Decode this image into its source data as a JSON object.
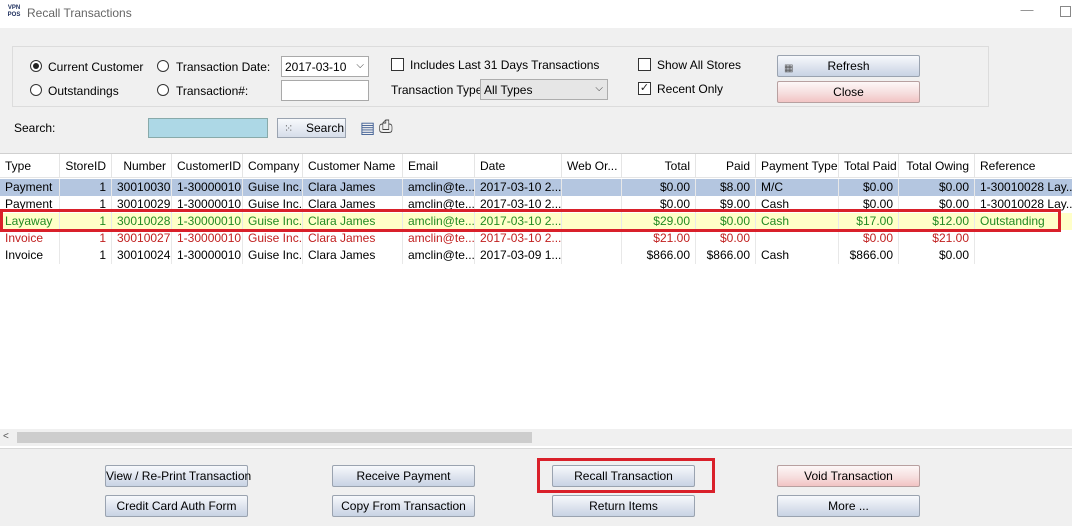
{
  "window": {
    "logo_text": "VPN POS",
    "title": "Recall Transactions",
    "minimize_glyph": "—"
  },
  "filters": {
    "current_customer": "Current Customer",
    "outstandings": "Outstandings",
    "transaction_date": "Transaction Date:",
    "transaction_date_value": "2017-03-10",
    "transaction_no": "Transaction#:",
    "include_last_31": "Includes Last 31 Days Transactions",
    "transaction_type_label": "Transaction Type:",
    "transaction_type_value": "All Types",
    "show_all_stores": "Show All Stores",
    "recent_only": "Recent Only",
    "selected_radio": "current_customer",
    "recent_only_checked": true,
    "show_all_stores_checked": false,
    "include_last_31_checked": false
  },
  "actions": {
    "refresh": "Refresh",
    "close": "Close"
  },
  "search": {
    "label": "Search:",
    "button": "Search",
    "value": ""
  },
  "grid": {
    "columns": [
      "Type",
      "StoreID",
      "Number",
      "CustomerID",
      "Company",
      "Customer Name",
      "Email",
      "Date",
      "Web Or...",
      "Total",
      "Paid",
      "Payment Type",
      "Total Paid",
      "Total Owing",
      "Reference"
    ],
    "rows": [
      [
        "Payment",
        "1",
        "30010030",
        "1-30000010",
        "Guise Inc.",
        "Clara James",
        "amclin@te...",
        "2017-03-10 2...",
        "",
        "$0.00",
        "$8.00",
        "M/C",
        "$0.00",
        "$0.00",
        "1-30010028 Lay..."
      ],
      [
        "Payment",
        "1",
        "30010029",
        "1-30000010",
        "Guise Inc.",
        "Clara James",
        "amclin@te...",
        "2017-03-10 2...",
        "",
        "$0.00",
        "$9.00",
        "Cash",
        "$0.00",
        "$0.00",
        "1-30010028 Lay..."
      ],
      [
        "Layaway",
        "1",
        "30010028",
        "1-30000010",
        "Guise Inc.",
        "Clara James",
        "amclin@te...",
        "2017-03-10 2...",
        "",
        "$29.00",
        "$0.00",
        "Cash",
        "$17.00",
        "$12.00",
        "Outstanding"
      ],
      [
        "Invoice",
        "1",
        "30010027",
        "1-30000010",
        "Guise Inc.",
        "Clara James",
        "amclin@te...",
        "2017-03-10 2...",
        "",
        "$21.00",
        "$0.00",
        "",
        "$0.00",
        "$21.00",
        ""
      ],
      [
        "Invoice",
        "1",
        "30010024",
        "1-30000010",
        "Guise Inc.",
        "Clara James",
        "amclin@te...",
        "2017-03-09 1...",
        "",
        "$866.00",
        "$866.00",
        "Cash",
        "$866.00",
        "$0.00",
        ""
      ]
    ],
    "scroll_left_glyph": "<"
  },
  "bottom_buttons": {
    "view_reprint": "View / Re-Print Transaction",
    "credit_card_auth": "Credit Card Auth Form",
    "receive_payment": "Receive Payment",
    "copy_from": "Copy From Transaction",
    "recall": "Recall Transaction",
    "return_items": "Return Items",
    "void": "Void Transaction",
    "more": "More ..."
  },
  "colors": {
    "selected_row": "#b4c6e0",
    "layaway_text": "#238b23",
    "layaway_bg": "#ffffc8",
    "invoice_red": "#c02020",
    "highlight": "#d9202a",
    "search_input_bg": "#add8e6"
  }
}
